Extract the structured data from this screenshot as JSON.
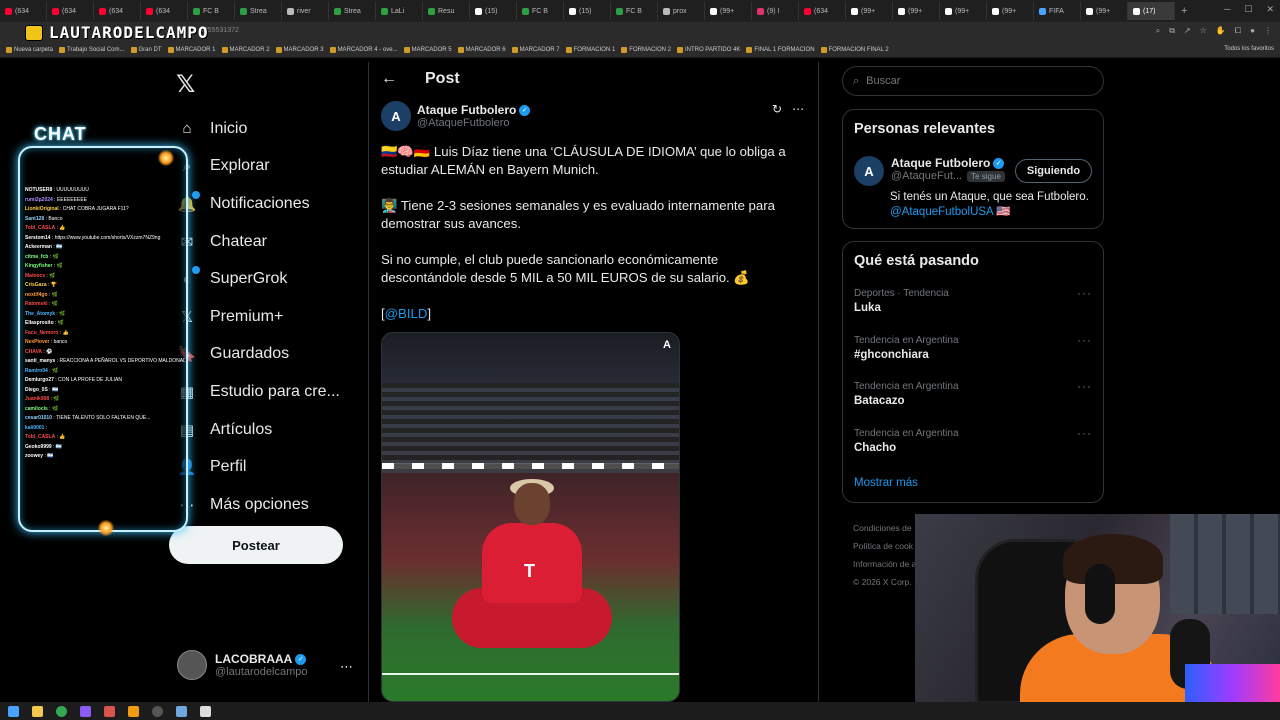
{
  "browser": {
    "tabs": [
      {
        "label": "(634",
        "color": "#ff0033"
      },
      {
        "label": "(634",
        "color": "#ff0033"
      },
      {
        "label": "(634",
        "color": "#ff0033"
      },
      {
        "label": "(634",
        "color": "#ff0033"
      },
      {
        "label": "FC B",
        "color": "#2ea043"
      },
      {
        "label": "Strea",
        "color": "#2ea043"
      },
      {
        "label": "river",
        "color": "#bbbbbb"
      },
      {
        "label": "Strea",
        "color": "#2ea043"
      },
      {
        "label": "LaLi",
        "color": "#2ea043"
      },
      {
        "label": "Resu",
        "color": "#2ea043"
      },
      {
        "label": "(15)",
        "color": "#ffffff"
      },
      {
        "label": "FC B",
        "color": "#2ea043"
      },
      {
        "label": "(15)",
        "color": "#ffffff"
      },
      {
        "label": "FC B",
        "color": "#2ea043"
      },
      {
        "label": "prox",
        "color": "#bbbbbb"
      },
      {
        "label": "(99+",
        "color": "#ffffff"
      },
      {
        "label": "(9) I",
        "color": "#e1306c"
      },
      {
        "label": "(634",
        "color": "#ff0033"
      },
      {
        "label": "(99+",
        "color": "#ffffff"
      },
      {
        "label": "(99+",
        "color": "#ffffff"
      },
      {
        "label": "(99+",
        "color": "#ffffff"
      },
      {
        "label": "(99+",
        "color": "#ffffff"
      },
      {
        "label": "FIFA",
        "color": "#4aa3ff"
      },
      {
        "label": "(99+",
        "color": "#ffffff"
      },
      {
        "label": "(17)",
        "color": "#ffffff"
      }
    ],
    "url_fragment": "4255531372",
    "bookmarks": [
      "Nueva carpeta",
      "Trabajo Social Com...",
      "Gran DT",
      "MARCADOR 1",
      "MARCADOR 2",
      "MARCADOR 3",
      "MARCADOR 4 - ove...",
      "MARCADOR 5",
      "MARCADOR 6",
      "MARCADOR 7",
      "FORMACION 1",
      "FORMACION 2",
      "INTRO PARTIDO 4K",
      "FINAL 1 FORMACION",
      "FORMACION FINAL 2"
    ],
    "bookmarks_right": "Todos los favoritos"
  },
  "stream_logo": "LAUTARODELCAMPO",
  "chat": {
    "title": "CHAT",
    "messages": [
      {
        "user": "NOTUSER8",
        "text": "UUUUUUUUU",
        "color": "#ffffff"
      },
      {
        "user": "rumi2p2024",
        "text": "EEEEEEEEE",
        "color": "#b48cff"
      },
      {
        "user": "LionkiOriginal",
        "text": "CHAT COBRA JUGARA F11?",
        "color": "#ffd23f"
      },
      {
        "user": "Sant128",
        "text": "Banco",
        "color": "#8fd3ff"
      },
      {
        "user": "Tobi_CASLA",
        "text": "👍",
        "color": "#ff4b4b"
      },
      {
        "user": "Serstom14",
        "text": "https://www.youtube.com/shorts/VXzzm7NZ9ng",
        "color": "#ffffff"
      },
      {
        "user": "Ackeerman",
        "text": "🇦🇷",
        "color": "#ffffff"
      },
      {
        "user": "citma_fcb",
        "text": "🌿",
        "color": "#7dff7d"
      },
      {
        "user": "Kingyfisher",
        "text": "🌿",
        "color": "#7dff7d"
      },
      {
        "user": "Mateocs",
        "text": "🌿",
        "color": "#ff4b4b"
      },
      {
        "user": "CrisGaza",
        "text": "🏆",
        "color": "#ffd23f"
      },
      {
        "user": "noxtif4go",
        "text": "🌿",
        "color": "#ff9b3b"
      },
      {
        "user": "Ratomski",
        "text": "🌿",
        "color": "#ff4b4b"
      },
      {
        "user": "The_Atomyk",
        "text": "🌿",
        "color": "#4fb8ff"
      },
      {
        "user": "Ellasprosito",
        "text": "🌿",
        "color": "#ffffff"
      },
      {
        "user": "Facu_Nemoro",
        "text": "👍",
        "color": "#ff4b4b"
      },
      {
        "user": "NexPlover",
        "text": "banco",
        "color": "#ff9b3b"
      },
      {
        "user": "CHAVA",
        "text": "⚽",
        "color": "#ff4b4b"
      },
      {
        "user": "santi_manys",
        "text": "REACCIONA A PEÑAROL VS DEPORTIVO MALDONADO COBRIX",
        "color": "#ffffff"
      },
      {
        "user": "Ramiro04",
        "text": "🌿",
        "color": "#4fb8ff"
      },
      {
        "user": "Demlurgo27",
        "text": "CON LA PROFE DE JULIAN",
        "color": "#ffffff"
      },
      {
        "user": "Diego_0S",
        "text": "🇦🇷",
        "color": "#ffffff"
      },
      {
        "user": "Juanik908",
        "text": "🌿",
        "color": "#ff4b4b"
      },
      {
        "user": "camilocls",
        "text": "🌿",
        "color": "#7dff7d"
      },
      {
        "user": "cesar01010",
        "text": "TIENE TALENTO SOLO FALTA EN QUE...",
        "color": "#8fd3ff"
      },
      {
        "user": "kali0001",
        "text": "",
        "color": "#4fb8ff"
      },
      {
        "user": "Tobi_CASLA",
        "text": "👍",
        "color": "#ff4b4b"
      },
      {
        "user": "Geoko9999",
        "text": "🇦🇷",
        "color": "#ffffff"
      },
      {
        "user": "zoowey",
        "text": "🇦🇷",
        "color": "#ffffff"
      }
    ]
  },
  "nav": {
    "items": [
      {
        "label": "Inicio",
        "icon": "home-icon",
        "glyph": "⌂"
      },
      {
        "label": "Explorar",
        "icon": "search-icon",
        "glyph": "⌕"
      },
      {
        "label": "Notificaciones",
        "icon": "bell-icon",
        "glyph": "🔔"
      },
      {
        "label": "Chatear",
        "icon": "mail-icon",
        "glyph": "✉"
      },
      {
        "label": "SuperGrok",
        "icon": "grok-icon",
        "glyph": "◐"
      },
      {
        "label": "Premium+",
        "icon": "x-premium-icon",
        "glyph": "𝕏"
      },
      {
        "label": "Guardados",
        "icon": "bookmark-icon",
        "glyph": "🔖"
      },
      {
        "label": "Estudio para cre...",
        "icon": "creator-studio-icon",
        "glyph": "▦"
      },
      {
        "label": "Artículos",
        "icon": "article-icon",
        "glyph": "▤"
      },
      {
        "label": "Perfil",
        "icon": "profile-icon",
        "glyph": "👤"
      },
      {
        "label": "Más opciones",
        "icon": "more-options-icon",
        "glyph": "⋯"
      }
    ],
    "post_button": "Postear"
  },
  "account": {
    "name": "LACOBRAAA",
    "handle": "@lautarodelcampo"
  },
  "post": {
    "header": "Post",
    "author_name": "Ataque Futbolero",
    "author_handle": "@AtaqueFutbolero",
    "avatar_glyph": "A",
    "paragraphs": [
      "🇨🇴🧠🇩🇪 Luis Díaz tiene una ‘CLÁUSULA DE IDIOMA’ que lo obliga a estudiar ALEMÁN en Bayern Munich.",
      "👨‍🏫 Tiene 2-3 sesiones semanales y es evaluado internamente para demostrar sus avances.",
      "Si no cumple, el club puede sancionarlo económicamente descontándole desde 5 MIL a 50 MIL EUROS de su salario. 💰"
    ],
    "mention_prefix": "[",
    "mention": "@BILD",
    "mention_suffix": "]",
    "media_watermark": "A"
  },
  "search": {
    "placeholder": "Buscar"
  },
  "relevant": {
    "title": "Personas relevantes",
    "name": "Ataque Futbolero",
    "handle": "@AtaqueFut...",
    "follows_you": "Te sigue",
    "button": "Siguiendo",
    "bio": "Si tenés un Ataque, que sea Futbolero.",
    "bio_link": "@AtaqueFutbolUSA 🇺🇸"
  },
  "trends": {
    "title": "Qué está pasando",
    "items": [
      {
        "category": "Deportes · Tendencia",
        "name": "Luka"
      },
      {
        "category": "Tendencia en Argentina",
        "name": "#ghconchiara"
      },
      {
        "category": "Tendencia en Argentina",
        "name": "Batacazo"
      },
      {
        "category": "Tendencia en Argentina",
        "name": "Chacho"
      }
    ],
    "show_more": "Mostrar más"
  },
  "footer": [
    "Condiciones de",
    "Política de cook",
    "Información de a",
    "© 2026 X Corp."
  ]
}
